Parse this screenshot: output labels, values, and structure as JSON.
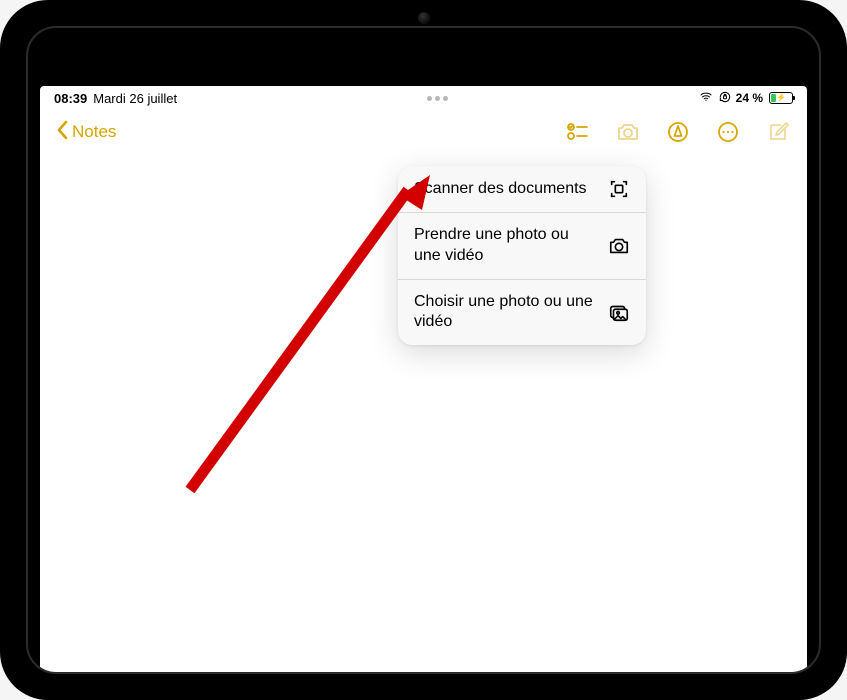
{
  "status": {
    "time": "08:39",
    "date": "Mardi 26 juillet",
    "battery_text": "24 %",
    "battery_percent": 24
  },
  "nav": {
    "back_label": "Notes",
    "accent": "#d6a500"
  },
  "popover": {
    "items": [
      {
        "label": "Scanner des documents",
        "icon": "scan-icon"
      },
      {
        "label": "Prendre une photo ou une vidéo",
        "icon": "camera-icon"
      },
      {
        "label": "Choisir une photo ou une vidéo",
        "icon": "gallery-icon"
      }
    ]
  }
}
